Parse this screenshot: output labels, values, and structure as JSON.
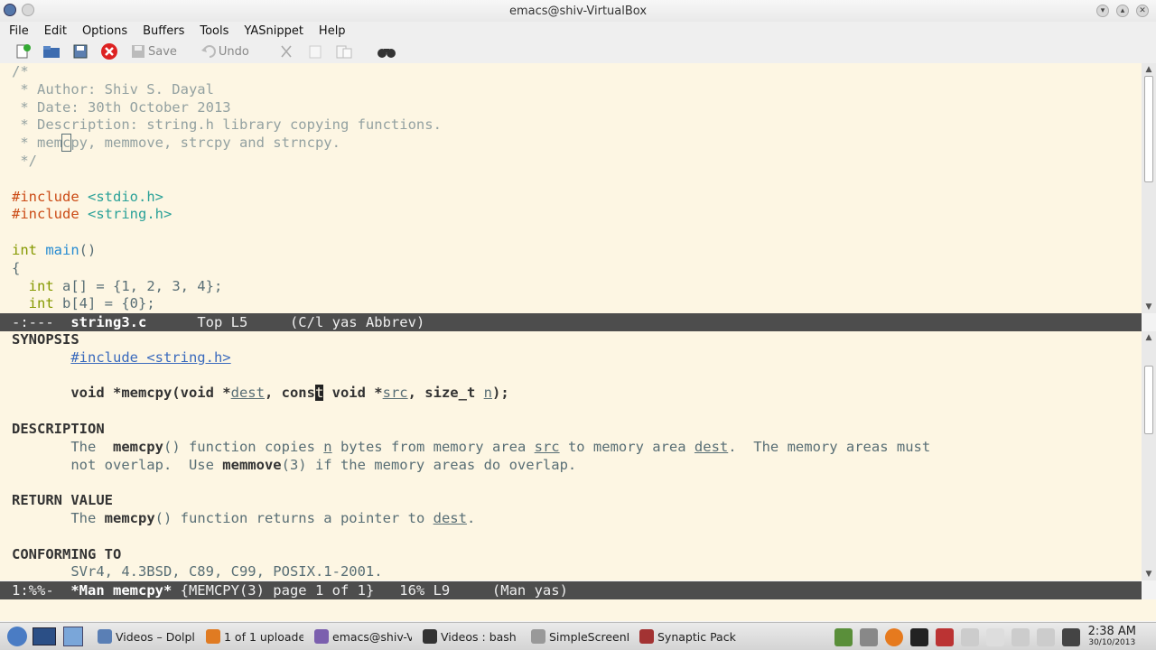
{
  "window": {
    "title": "emacs@shiv-VirtualBox"
  },
  "menu": [
    "File",
    "Edit",
    "Options",
    "Buffers",
    "Tools",
    "YASnippet",
    "Help"
  ],
  "toolbar": {
    "save_label": "Save",
    "undo_label": "Undo"
  },
  "editor": {
    "lines": [
      [
        {
          "t": "/*",
          "c": "c-comment"
        }
      ],
      [
        {
          "t": " * Author: Shiv S. Dayal",
          "c": "c-comment"
        }
      ],
      [
        {
          "t": " * Date: 30th October 2013",
          "c": "c-comment"
        }
      ],
      [
        {
          "t": " * Description: string.h library copying functions.",
          "c": "c-comment"
        }
      ],
      [
        {
          "t": " * mem",
          "c": "c-comment"
        },
        {
          "t": "c",
          "c": "c-comment cursor-box"
        },
        {
          "t": "py, memmove, strcpy and strncpy.",
          "c": "c-comment"
        }
      ],
      [
        {
          "t": " */",
          "c": "c-comment"
        }
      ],
      [
        {
          "t": "",
          "c": ""
        }
      ],
      [
        {
          "t": "#include ",
          "c": "c-pre"
        },
        {
          "t": "<stdio.h>",
          "c": "c-str"
        }
      ],
      [
        {
          "t": "#include ",
          "c": "c-pre"
        },
        {
          "t": "<string.h>",
          "c": "c-str"
        }
      ],
      [
        {
          "t": "",
          "c": ""
        }
      ],
      [
        {
          "t": "int ",
          "c": "c-type"
        },
        {
          "t": "main",
          "c": "c-fn"
        },
        {
          "t": "()",
          "c": "c-txt"
        }
      ],
      [
        {
          "t": "{",
          "c": "c-txt"
        }
      ],
      [
        {
          "t": "  int ",
          "c": "c-type"
        },
        {
          "t": "a[] = {1, 2, 3, 4};",
          "c": "c-txt"
        }
      ],
      [
        {
          "t": "  int ",
          "c": "c-type"
        },
        {
          "t": "b[4] = {0};",
          "c": "c-txt"
        }
      ]
    ]
  },
  "modeline1": {
    "status": "-:---  ",
    "buffer": "string3.c",
    "rest": "      Top L5     (C/l yas Abbrev)"
  },
  "man": {
    "lines": [
      [
        {
          "t": "SYNOPSIS",
          "c": "b"
        }
      ],
      [
        {
          "t": "       ",
          "c": ""
        },
        {
          "t": "#include <string.h>",
          "c": "u"
        }
      ],
      [
        {
          "t": "",
          "c": ""
        }
      ],
      [
        {
          "t": "       void *memcpy(void *",
          "c": "b"
        },
        {
          "t": "dest",
          "c": "u2"
        },
        {
          "t": ", cons",
          "c": "b"
        },
        {
          "t": "t",
          "c": "cursor-fill"
        },
        {
          "t": " void *",
          "c": "b"
        },
        {
          "t": "src",
          "c": "u2"
        },
        {
          "t": ", size_t ",
          "c": "b"
        },
        {
          "t": "n",
          "c": "u2"
        },
        {
          "t": ");",
          "c": "b"
        }
      ],
      [
        {
          "t": "",
          "c": ""
        }
      ],
      [
        {
          "t": "DESCRIPTION",
          "c": "b"
        }
      ],
      [
        {
          "t": "       The  ",
          "c": "c-txt"
        },
        {
          "t": "memcpy",
          "c": "b"
        },
        {
          "t": "() function copies ",
          "c": "c-txt"
        },
        {
          "t": "n",
          "c": "u2"
        },
        {
          "t": " bytes from memory area ",
          "c": "c-txt"
        },
        {
          "t": "src",
          "c": "u2"
        },
        {
          "t": " to memory area ",
          "c": "c-txt"
        },
        {
          "t": "dest",
          "c": "u2"
        },
        {
          "t": ".  The memory areas must",
          "c": "c-txt"
        }
      ],
      [
        {
          "t": "       not overlap.  Use ",
          "c": "c-txt"
        },
        {
          "t": "memmove",
          "c": "b"
        },
        {
          "t": "(3) if the memory areas do overlap.",
          "c": "c-txt"
        }
      ],
      [
        {
          "t": "",
          "c": ""
        }
      ],
      [
        {
          "t": "RETURN VALUE",
          "c": "b"
        }
      ],
      [
        {
          "t": "       The ",
          "c": "c-txt"
        },
        {
          "t": "memcpy",
          "c": "b"
        },
        {
          "t": "() function returns a pointer to ",
          "c": "c-txt"
        },
        {
          "t": "dest",
          "c": "u2"
        },
        {
          "t": ".",
          "c": "c-txt"
        }
      ],
      [
        {
          "t": "",
          "c": ""
        }
      ],
      [
        {
          "t": "CONFORMING TO",
          "c": "b"
        }
      ],
      [
        {
          "t": "       SVr4, 4.3BSD, C89, C99, POSIX.1-2001.",
          "c": "c-txt"
        }
      ]
    ]
  },
  "modeline2": {
    "status": "1:%%-  ",
    "buffer": "*Man memcpy*",
    "rest": " {MEMCPY(3) page 1 of 1}   16% L9     (Man yas)"
  },
  "taskbar": {
    "tasks": [
      {
        "label": "Videos – Dolpl",
        "color": "#5a7fb5"
      },
      {
        "label": "1 of 1 uploade",
        "color": "#e07b22"
      },
      {
        "label": "emacs@shiv-V",
        "color": "#7b5fae"
      },
      {
        "label": "Videos : bash",
        "color": "#333333"
      },
      {
        "label": "SimpleScreenI",
        "color": "#999999"
      },
      {
        "label": "Synaptic Pack",
        "color": "#a33333"
      }
    ],
    "clock_time": "2:38 AM",
    "clock_date": "30/10/2013"
  }
}
